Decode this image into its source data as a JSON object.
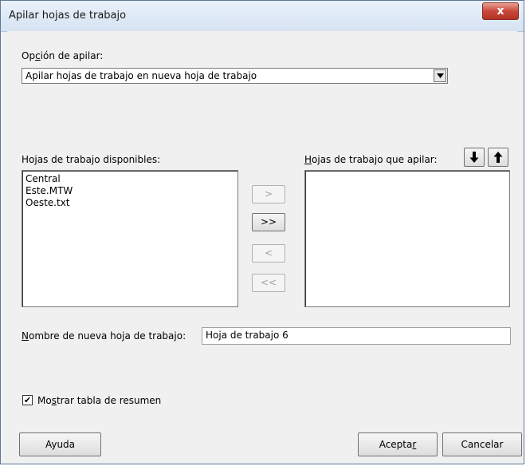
{
  "window": {
    "title": "Apilar hojas de trabajo",
    "close_label": "x"
  },
  "stack_option": {
    "label_prefix": "Op",
    "label_mnemonic": "c",
    "label_suffix": "ión de apilar:",
    "selected": "Apilar hojas de trabajo en nueva hoja de trabajo"
  },
  "available": {
    "label_prefix": "Ho",
    "label_mnemonic": "j",
    "label_suffix": "as de trabajo disponibles:",
    "items": [
      "Central",
      "Este.MTW",
      "Oeste.txt"
    ]
  },
  "to_stack": {
    "label_mnemonic": "H",
    "label_suffix": "ojas de trabajo que apilar:",
    "items": [],
    "move_down_icon": "arrow-down-icon",
    "move_up_icon": "arrow-up-icon"
  },
  "transfer_buttons": {
    "add": ">",
    "add_all": ">>",
    "remove": "<",
    "remove_all": "<<"
  },
  "new_sheet_name": {
    "label_mnemonic": "N",
    "label_suffix": "ombre de nueva hoja de trabajo:",
    "value": "Hoja de trabajo 6"
  },
  "summary": {
    "checked": true,
    "check_mark": "✔",
    "label_prefix": "Mo",
    "label_mnemonic": "s",
    "label_suffix": "trar tabla de resumen"
  },
  "footer": {
    "help_label": "Ayuda",
    "ok_prefix": "Acepta",
    "ok_mnemonic": "r",
    "cancel_label": "Cancelar"
  }
}
